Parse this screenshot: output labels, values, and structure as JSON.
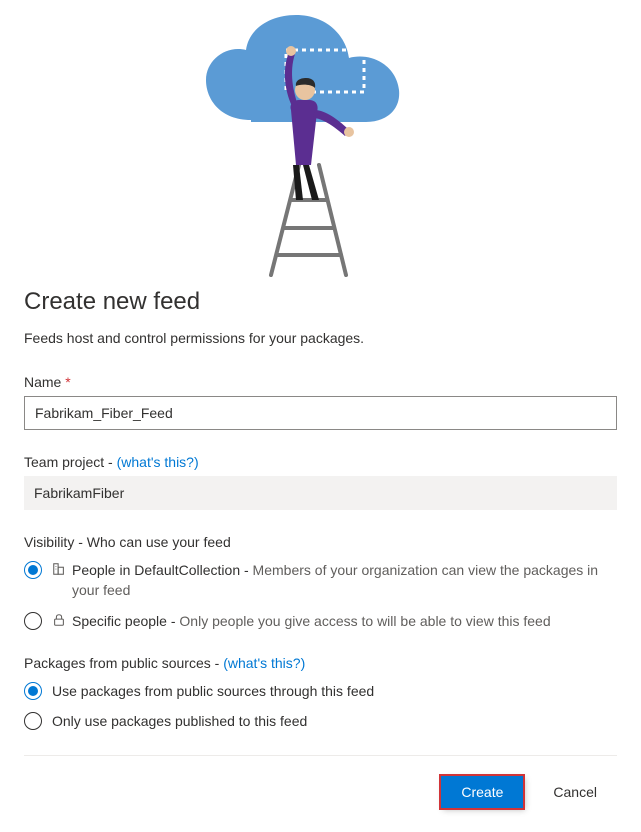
{
  "title": "Create new feed",
  "subtitle": "Feeds host and control permissions for your packages.",
  "name": {
    "label": "Name",
    "required_marker": "*",
    "value": "Fabrikam_Fiber_Feed"
  },
  "team_project": {
    "label": "Team project - ",
    "help_link": "(what's this?)",
    "value": "FabrikamFiber"
  },
  "visibility": {
    "label": "Visibility - Who can use your feed",
    "options": [
      {
        "icon": "organization-icon",
        "label": "People in DefaultCollection - ",
        "desc": "Members of your organization can view the packages in your feed",
        "checked": true
      },
      {
        "icon": "lock-icon",
        "label": "Specific people - ",
        "desc": "Only people you give access to will be able to view this feed",
        "checked": false
      }
    ]
  },
  "public_sources": {
    "label": "Packages from public sources - ",
    "help_link": "(what's this?)",
    "options": [
      {
        "label": "Use packages from public sources through this feed",
        "checked": true
      },
      {
        "label": "Only use packages published to this feed",
        "checked": false
      }
    ]
  },
  "footer": {
    "create_label": "Create",
    "cancel_label": "Cancel"
  }
}
